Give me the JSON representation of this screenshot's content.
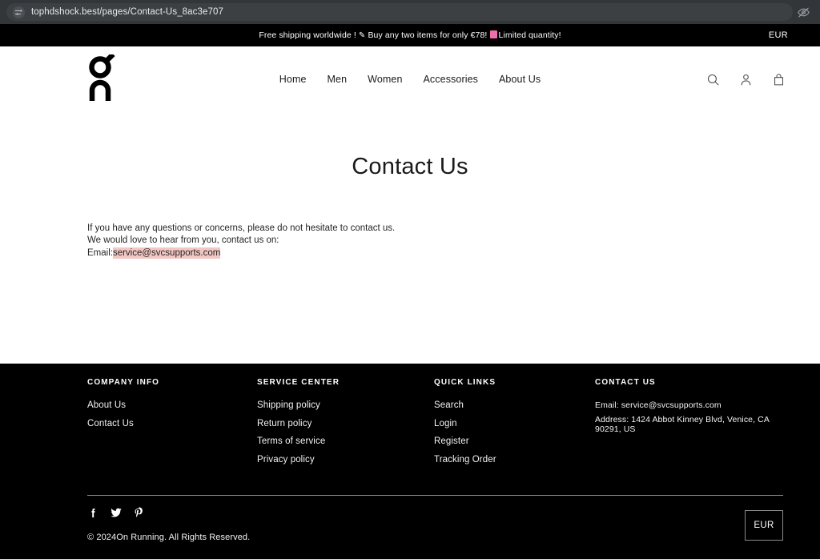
{
  "browser": {
    "url": "tophdshock.best/pages/Contact-Us_8ac3e707",
    "page_info_icon": "page-settings-icon",
    "right_icon": "eye-slash-icon"
  },
  "announcement": {
    "text_before": "Free shipping worldwide !",
    "emoji_pen": "✎",
    "text_middle": "Buy any two items for only €78!",
    "text_after": "Limited quantity!",
    "currency": "EUR",
    "background": "#000000",
    "emoji_box_color": "#f06ea9"
  },
  "header": {
    "logo_name": "on-running-logo",
    "nav": [
      {
        "label": "Home"
      },
      {
        "label": "Men"
      },
      {
        "label": "Women"
      },
      {
        "label": "Accessories"
      },
      {
        "label": "About Us"
      }
    ],
    "icons": [
      {
        "name": "search-icon"
      },
      {
        "name": "account-icon"
      },
      {
        "name": "cart-icon"
      }
    ]
  },
  "main": {
    "title": "Contact Us",
    "line1": "If you have any questions or concerns, please do not hesitate to contact us.",
    "line2": "We would love to hear from you, contact us on:",
    "email_label": "Email:",
    "email": "service@svcsupports.com",
    "email_highlight_color": "#f2c6c3"
  },
  "footer": {
    "columns": [
      {
        "heading": "COMPANY INFO",
        "links": [
          {
            "label": "About Us"
          },
          {
            "label": "Contact Us"
          }
        ]
      },
      {
        "heading": "SERVICE CENTER",
        "links": [
          {
            "label": "Shipping policy"
          },
          {
            "label": "Return policy"
          },
          {
            "label": "Terms of service"
          },
          {
            "label": "Privacy policy"
          }
        ]
      },
      {
        "heading": "QUICK LINKS",
        "links": [
          {
            "label": "Search"
          },
          {
            "label": "Login"
          },
          {
            "label": "Register"
          },
          {
            "label": "Tracking Order"
          }
        ]
      }
    ],
    "contact": {
      "heading": "CONTACT US",
      "email_line": "Email: service@svcsupports.com",
      "address_line": "Address: 1424 Abbot Kinney Blvd, Venice, CA 90291, US"
    },
    "socials": [
      {
        "name": "facebook-icon"
      },
      {
        "name": "twitter-icon"
      },
      {
        "name": "pinterest-icon"
      }
    ],
    "copyright": "© 2024On Running. All Rights Reserved.",
    "currency": "EUR"
  }
}
